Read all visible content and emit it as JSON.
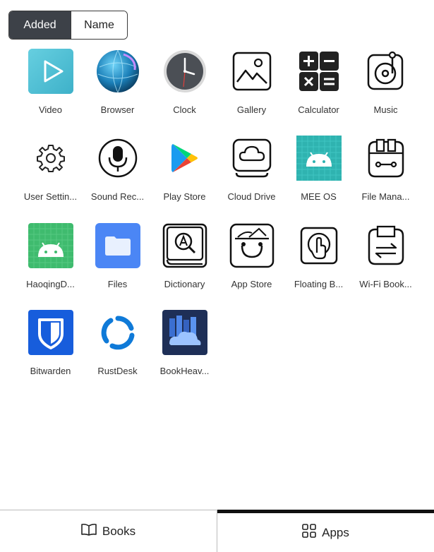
{
  "sort": {
    "active": "Added",
    "other": "Name"
  },
  "apps": [
    {
      "label": "Video",
      "icon": "video-icon"
    },
    {
      "label": "Browser",
      "icon": "browser-globe-icon"
    },
    {
      "label": "Clock",
      "icon": "clock-icon"
    },
    {
      "label": "Gallery",
      "icon": "gallery-icon"
    },
    {
      "label": "Calculator",
      "icon": "calculator-icon"
    },
    {
      "label": "Music",
      "icon": "music-icon"
    },
    {
      "label": "User Settin...",
      "icon": "gear-icon"
    },
    {
      "label": "Sound Rec...",
      "icon": "microphone-icon"
    },
    {
      "label": "Play Store",
      "icon": "play-store-icon"
    },
    {
      "label": "Cloud Drive",
      "icon": "cloud-drive-icon"
    },
    {
      "label": "MEE OS",
      "icon": "android-icon"
    },
    {
      "label": "File Mana...",
      "icon": "file-manager-icon"
    },
    {
      "label": "HaoqingD...",
      "icon": "android-icon"
    },
    {
      "label": "Files",
      "icon": "folder-icon"
    },
    {
      "label": "Dictionary",
      "icon": "dictionary-icon"
    },
    {
      "label": "App Store",
      "icon": "app-store-icon"
    },
    {
      "label": "Floating B...",
      "icon": "floating-ball-icon"
    },
    {
      "label": "Wi-Fi Book...",
      "icon": "wifi-transfer-icon"
    },
    {
      "label": "Bitwarden",
      "icon": "bitwarden-shield-icon"
    },
    {
      "label": "RustDesk",
      "icon": "rustdesk-icon"
    },
    {
      "label": "BookHeav...",
      "icon": "bookheaven-icon"
    }
  ],
  "bottom_nav": {
    "books": "Books",
    "apps": "Apps"
  },
  "colors": {
    "teal": "#2fb3b0",
    "android_green": "#3ddc84",
    "files_blue": "#4b86f5",
    "bitwarden_blue": "#175ddc",
    "rustdesk_blue": "#0f7ad8"
  }
}
